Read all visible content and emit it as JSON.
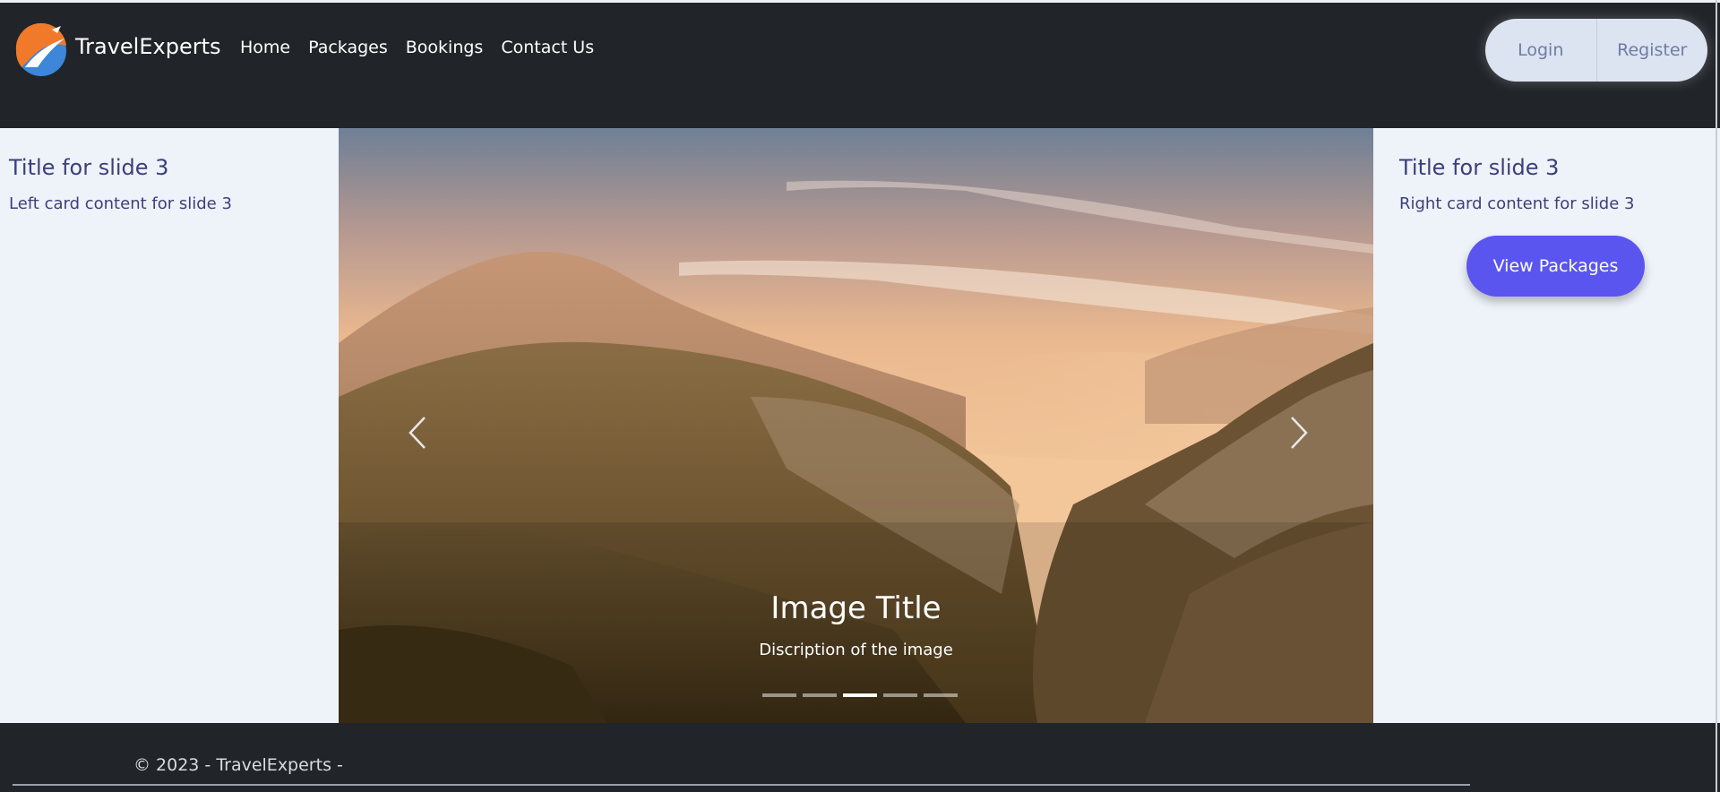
{
  "brand": {
    "name": "TravelExperts",
    "logo_icon": "globe-plane-logo"
  },
  "nav": {
    "links": [
      "Home",
      "Packages",
      "Bookings",
      "Contact Us"
    ]
  },
  "auth": {
    "login": "Login",
    "register": "Register"
  },
  "carousel": {
    "left_card": {
      "title": "Title for slide 3",
      "text": "Left card content for slide 3"
    },
    "right_card": {
      "title": "Title for slide 3",
      "text": "Right card content for slide 3",
      "button": "View Packages"
    },
    "caption": {
      "title": "Image Title",
      "description": "Discription of the image"
    },
    "indicator_count": 5,
    "active_index": 2,
    "prev_icon": "chevron-left-icon",
    "next_icon": "chevron-right-icon"
  },
  "footer": {
    "text": "© 2023 - TravelExperts -"
  },
  "colors": {
    "navbar": "#212529",
    "card_bg": "#eef3fa",
    "accent": "#5a55ef",
    "card_text": "#3b3f7a"
  }
}
